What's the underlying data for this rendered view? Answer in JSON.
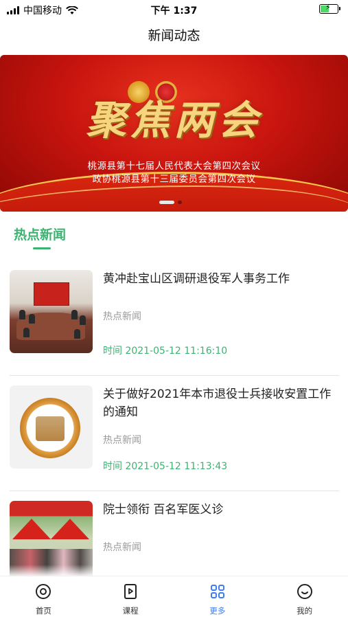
{
  "status_bar": {
    "carrier": "中国移动",
    "time": "下午 1:37",
    "battery_level": 0.55,
    "icons": [
      "signal-icon",
      "wifi-icon",
      "battery-charging-icon"
    ]
  },
  "header": {
    "title": "新闻动态"
  },
  "banner": {
    "headline": "聚焦两会",
    "line1": "桃源县第十七届人民代表大会第四次会议",
    "line2": "政协桃源县第十三届委员会第四次会议",
    "slide_count": 2,
    "active_slide": 1
  },
  "section": {
    "title": "热点新闻",
    "accent_color": "#3cb371"
  },
  "news": [
    {
      "title": "黄冲赴宝山区调研退役军人事务工作",
      "category": "热点新闻",
      "time": "时间  2021-05-12 11:16:10"
    },
    {
      "title": "关于做好2021年本市退役士兵接收安置工作的通知",
      "category": "热点新闻",
      "time": "时间  2021-05-12 11:13:43"
    },
    {
      "title": "院士领衔 百名军医义诊",
      "category": "热点新闻",
      "time": ""
    }
  ],
  "tab_bar": {
    "active_color": "#3b7ef3",
    "items": [
      {
        "label": "首页",
        "icon": "home-icon"
      },
      {
        "label": "课程",
        "icon": "course-icon"
      },
      {
        "label": "更多",
        "icon": "grid-icon"
      },
      {
        "label": "我的",
        "icon": "profile-icon"
      }
    ]
  }
}
